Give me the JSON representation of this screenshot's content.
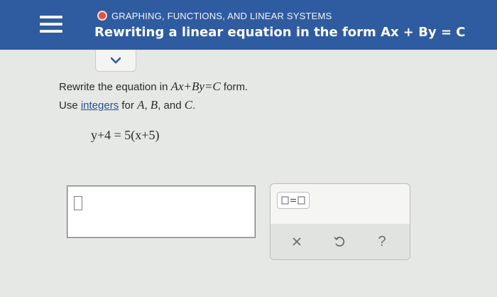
{
  "header": {
    "topic": "GRAPHING, FUNCTIONS, AND LINEAR SYSTEMS",
    "subtopic": "Rewriting a linear equation in the form Ax + By = C",
    "icons": {
      "menu": "hamburger-menu-icon",
      "status": "red-dot-icon",
      "expand": "chevron-down-icon"
    }
  },
  "problem": {
    "line1_prefix": "Rewrite the equation in ",
    "line1_form": "Ax+By=C",
    "line1_suffix": " form.",
    "line2_prefix": "Use ",
    "line2_link": "integers",
    "line2_mid": " for ",
    "var_a": "A",
    "sep1": ", ",
    "var_b": "B",
    "sep2": ", and ",
    "var_c": "C",
    "end": ".",
    "equation": "y+4 = 5(x+5)"
  },
  "keypad": {
    "icons": [
      "equation-template-icon",
      "clear-x-icon",
      "undo-icon",
      "help-icon"
    ],
    "help_label": "?"
  },
  "colors": {
    "header_bg": "#2f5ba0",
    "accent_red": "#e2533a",
    "link": "#2a4f93"
  }
}
